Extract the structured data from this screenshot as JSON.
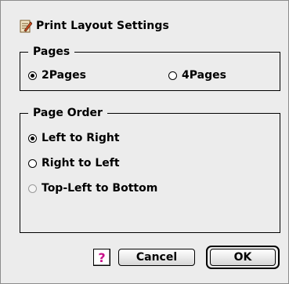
{
  "dialog": {
    "title": "Print Layout Settings",
    "icon": "document-pen-icon"
  },
  "pages_group": {
    "legend": "Pages",
    "options": [
      {
        "label": "2Pages",
        "selected": true
      },
      {
        "label": "4Pages",
        "selected": false
      }
    ]
  },
  "order_group": {
    "legend": "Page Order",
    "options": [
      {
        "label": "Left to Right",
        "selected": true,
        "enabled": true
      },
      {
        "label": "Right to Left",
        "selected": false,
        "enabled": true
      },
      {
        "label": "Top-Left to Bottom",
        "selected": false,
        "enabled": false
      }
    ]
  },
  "buttons": {
    "help": "?",
    "cancel": "Cancel",
    "ok": "OK"
  },
  "colors": {
    "help_accent": "#c8108a"
  }
}
